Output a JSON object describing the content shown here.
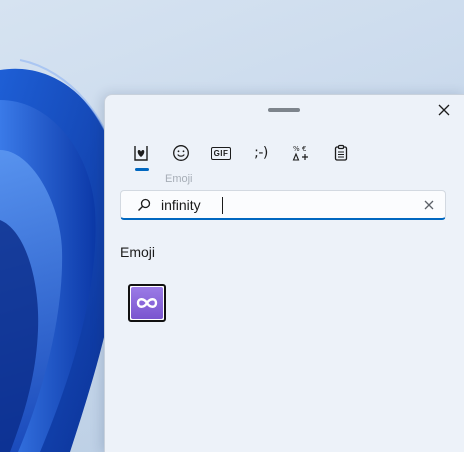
{
  "window": {
    "close_icon": "close-icon",
    "drag_handle_icon": "drag-handle-icon"
  },
  "tabs": [
    {
      "id": "recent",
      "icon": "heart-clipboard-icon",
      "selected": true
    },
    {
      "id": "emoji",
      "icon": "smiley-icon",
      "selected": false
    },
    {
      "id": "gif",
      "icon": "gif-icon",
      "label": "GIF",
      "selected": false
    },
    {
      "id": "kaomoji",
      "icon": "kaomoji-icon",
      "label": ";-)",
      "selected": false
    },
    {
      "id": "symbols",
      "icon": "symbols-icon",
      "selected": false
    },
    {
      "id": "clipboard",
      "icon": "clipboard-history-icon",
      "selected": false
    }
  ],
  "tooltip": {
    "text": "Emoji"
  },
  "search": {
    "value": "infinity",
    "icon": "search-icon",
    "clear_icon": "clear-icon"
  },
  "results": {
    "section_label": "Emoji",
    "items": [
      {
        "name": "infinity",
        "icon": "infinity-emoji-icon",
        "color": "#8a66dc"
      }
    ]
  },
  "colors": {
    "accent": "#0067c0",
    "panel_bg": "#edf2f9",
    "emoji_tile": "#8a66dc"
  }
}
